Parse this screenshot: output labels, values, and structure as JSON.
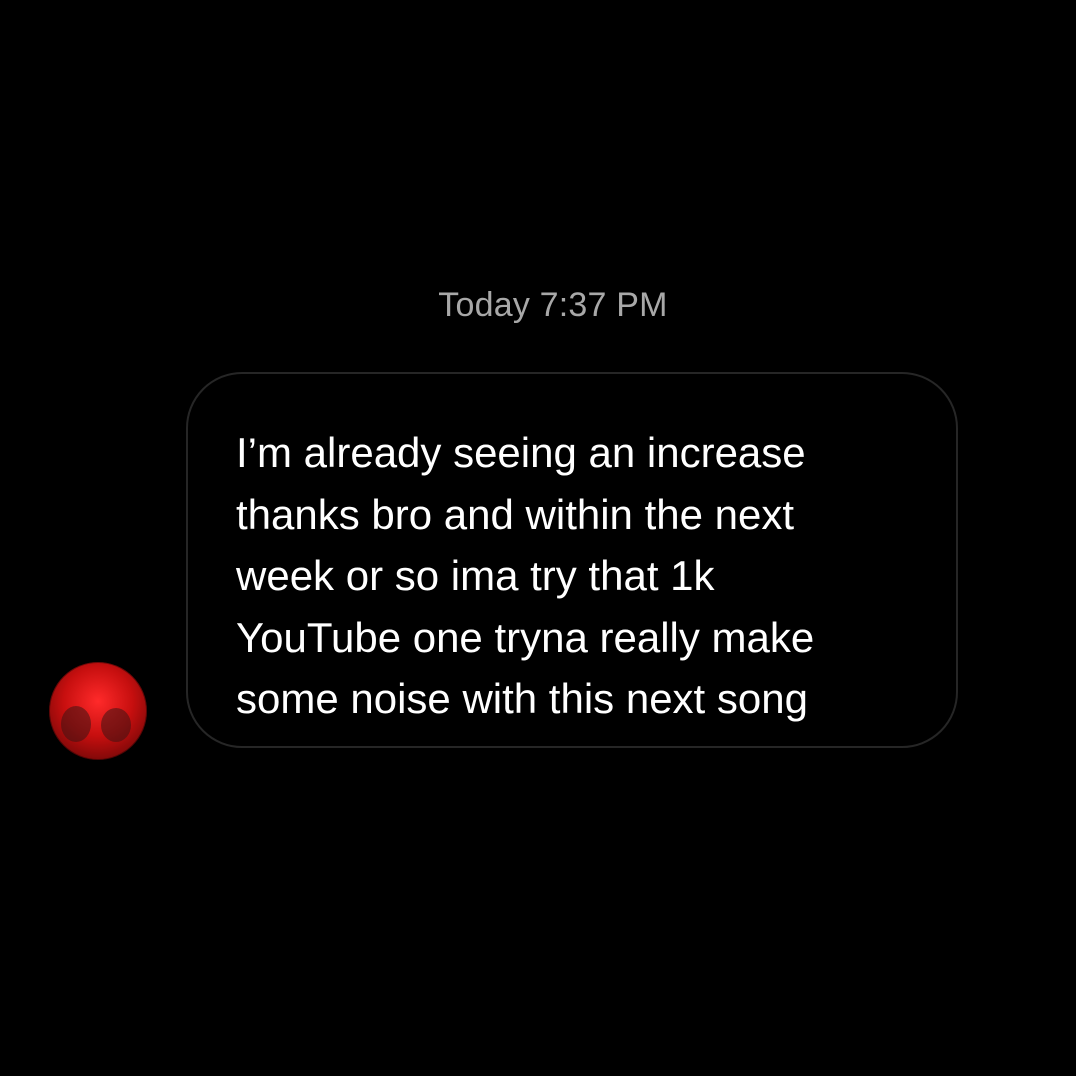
{
  "conversation": {
    "timestamp": "Today 7:37 PM",
    "messages": [
      {
        "sender": "other",
        "text": "I’m already seeing an increase\nthanks bro and within the next\nweek or so ima try that 1k\nYouTube one tryna really make\nsome noise with this next song"
      }
    ]
  },
  "avatar": {
    "icon": "profile-avatar",
    "accent_color": "#d11414"
  },
  "colors": {
    "background": "#000000",
    "bubble_border": "#262626",
    "message_text": "#ffffff",
    "timestamp_text": "#a8a8a8"
  }
}
